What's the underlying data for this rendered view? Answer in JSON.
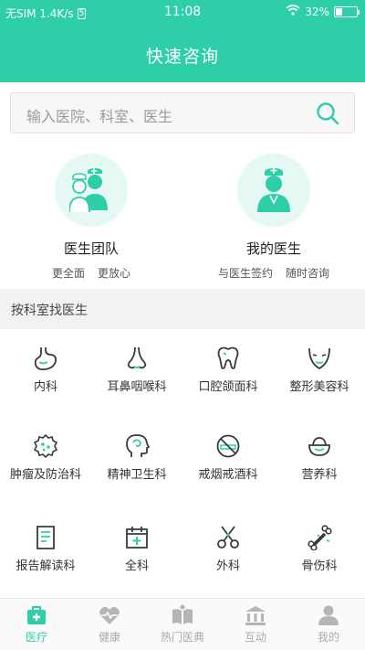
{
  "status_bar": {
    "carrier": "无SIM 1.4K/s",
    "sim_badge": "5",
    "time": "11:08",
    "battery_percent": "32%",
    "battery_level": 0.32
  },
  "header": {
    "title": "快速咨询"
  },
  "search": {
    "placeholder": "输入医院、科室、医生"
  },
  "services": [
    {
      "name": "医生团队",
      "subs": [
        "更全面",
        "更放心"
      ]
    },
    {
      "name": "我的医生",
      "subs": [
        "与医生签约",
        "随时咨询"
      ]
    }
  ],
  "section": {
    "title": "按科室找医生"
  },
  "departments": [
    {
      "label": "内科",
      "icon": "stomach-icon"
    },
    {
      "label": "耳鼻咽喉科",
      "icon": "nose-icon"
    },
    {
      "label": "口腔颌面科",
      "icon": "tooth-icon"
    },
    {
      "label": "整形美容科",
      "icon": "face-icon"
    },
    {
      "label": "肿瘤及防治科",
      "icon": "tumor-icon"
    },
    {
      "label": "精神卫生科",
      "icon": "head-icon"
    },
    {
      "label": "戒烟戒酒科",
      "icon": "no-smoking-icon"
    },
    {
      "label": "营养科",
      "icon": "bowl-icon"
    },
    {
      "label": "报告解读科",
      "icon": "report-icon"
    },
    {
      "label": "全科",
      "icon": "calendar-plus-icon"
    },
    {
      "label": "外科",
      "icon": "scissors-icon"
    },
    {
      "label": "骨伤科",
      "icon": "bone-icon"
    }
  ],
  "tabs": [
    {
      "label": "医疗",
      "icon": "medical-kit-icon",
      "active": true
    },
    {
      "label": "健康",
      "icon": "heart-pulse-icon",
      "active": false
    },
    {
      "label": "热门医典",
      "icon": "book-icon",
      "active": false
    },
    {
      "label": "互动",
      "icon": "building-icon",
      "active": false
    },
    {
      "label": "我的",
      "icon": "user-icon",
      "active": false
    }
  ],
  "colors": {
    "accent": "#2ecfa8",
    "icon_dark": "#3a3a3a",
    "tab_inactive": "#b5b5b5"
  }
}
